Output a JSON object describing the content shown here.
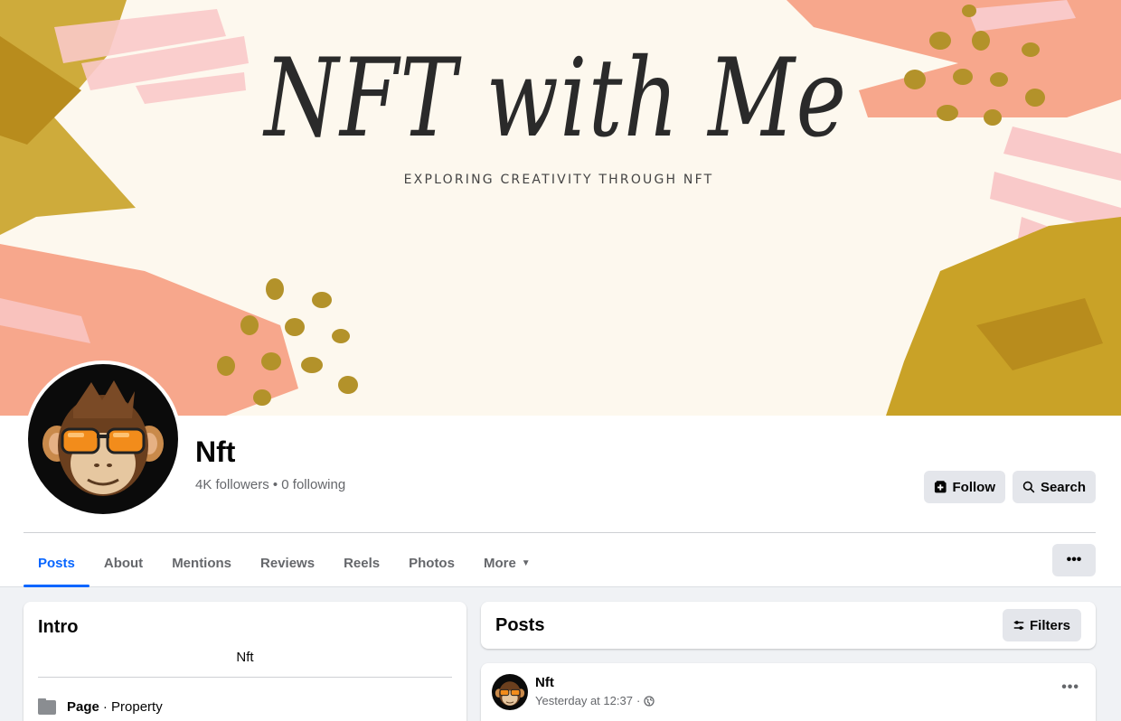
{
  "cover": {
    "title": "NFT with Me",
    "subtitle": "EXPLORING CREATIVITY THROUGH NFT",
    "colors": {
      "gold": "#c9a227",
      "coral": "#f7a78c",
      "pink": "#f9c9c9",
      "cream": "#fdf8ee"
    }
  },
  "profile": {
    "name": "Nft",
    "stats": "4K followers • 0 following",
    "avatar_icon": "monkey-sunglasses-avatar"
  },
  "actions": {
    "follow_label": "Follow",
    "search_label": "Search"
  },
  "tabs": [
    {
      "label": "Posts",
      "active": true
    },
    {
      "label": "About"
    },
    {
      "label": "Mentions"
    },
    {
      "label": "Reviews"
    },
    {
      "label": "Reels"
    },
    {
      "label": "Photos"
    },
    {
      "label": "More"
    }
  ],
  "more_menu_label": "•••",
  "intro": {
    "title": "Intro",
    "bio": "Nft",
    "category_label": "Page",
    "category_value": "· Property"
  },
  "posts": {
    "title": "Posts",
    "filters_label": "Filters"
  },
  "post": {
    "author": "Nft",
    "timestamp": "Yesterday at 12:37",
    "separator": "·",
    "privacy_icon": "globe-icon",
    "menu_label": "•••"
  },
  "accent": "#0866ff"
}
